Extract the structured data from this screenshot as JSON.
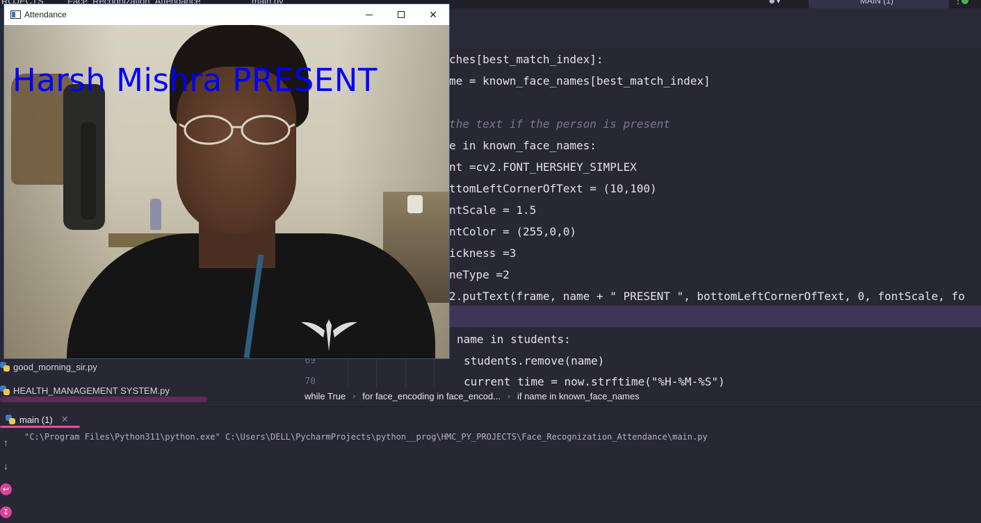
{
  "ide": {
    "topbar": {
      "crumbs": [
        "ROJECTS",
        "Face_Recognization_Attendance",
        "main.py"
      ],
      "run_config": "MAIN (1)"
    },
    "code": [
      {
        "id": "l1",
        "text": "ches[best_match_index]:"
      },
      {
        "id": "l2",
        "text": "me = known_face_names[best_match_index]"
      },
      {
        "id": "l3",
        "text": "the text if the person is present"
      },
      {
        "id": "l4",
        "text": "e in known_face_names:"
      },
      {
        "id": "l5",
        "text": "nt =cv2.FONT_HERSHEY_SIMPLEX"
      },
      {
        "id": "l6",
        "text": "ttomLeftCornerOfText = (10,100)"
      },
      {
        "id": "l7",
        "text": "ntScale = 1.5"
      },
      {
        "id": "l8",
        "text": "ntColor = (255,0,0)"
      },
      {
        "id": "l9",
        "text": "ickness =3"
      },
      {
        "id": "l10",
        "text": "neType =2"
      },
      {
        "id": "l11",
        "text": "2.putText(frame, name + \" PRESENT \", bottomLeftCornerOfText, 0, fontScale, fo"
      },
      {
        "id": "l12",
        "text": "name in students:"
      },
      {
        "id": "l13",
        "text": "students.remove(name)"
      },
      {
        "id": "l14",
        "text": "current_time = now.strftime(\"%H-%M-%S\")"
      }
    ],
    "line_numbers": {
      "n69": "69",
      "n70": "70"
    },
    "tree": [
      {
        "label": "good_morning_sir.py"
      },
      {
        "label": "HEALTH_MANAGEMENT SYSTEM.py"
      }
    ],
    "breadcrumb": [
      "while True",
      "for face_encoding in face_encod...",
      "if name in known_face_names"
    ]
  },
  "run": {
    "tab_label": "main (1)",
    "console": "\"C:\\Program Files\\Python311\\python.exe\" C:\\Users\\DELL\\PycharmProjects\\python__prog\\HMC_PY_PROJECTS\\Face_Recognization_Attendance\\main.py"
  },
  "attendance": {
    "title": "Attendance",
    "overlay_text": "Harsh Mishra PRESENT"
  },
  "colors": {
    "overlay": "#0000ff",
    "editor_bg": "#282734",
    "highlight_row": "#3e3557",
    "run_tab_underline": "#e34fa2"
  },
  "icons": [
    "minimize-icon",
    "maximize-icon",
    "close-icon",
    "python-file-icon",
    "arrow-up-icon",
    "arrow-down-icon",
    "soft-wrap-icon",
    "scroll-to-end-icon"
  ]
}
